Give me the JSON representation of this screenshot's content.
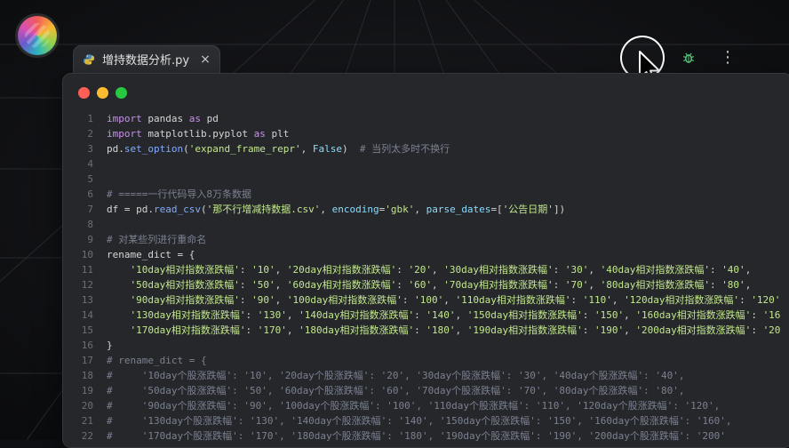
{
  "tab": {
    "title": "增持数据分析.py",
    "close_label": "×"
  },
  "toolbar": {
    "more_label": "⋮"
  },
  "icons": {
    "file_type_icon": "python-icon",
    "run_icon": "play-icon",
    "debug_icon": "bug-icon",
    "more_icon": "more-vertical-icon",
    "cursor_icon": "mouse-pointer-icon",
    "logo_icon": "app-logo-icon"
  },
  "colors": {
    "traffic_red": "#ff5f57",
    "traffic_yellow": "#febc2e",
    "traffic_green": "#28c840",
    "run_green": "#58d27f"
  },
  "code": {
    "lines": [
      {
        "n": "1",
        "segments": [
          [
            "k",
            "import"
          ],
          [
            "t",
            " pandas "
          ],
          [
            "k",
            "as"
          ],
          [
            "t",
            " pd"
          ]
        ]
      },
      {
        "n": "2",
        "segments": [
          [
            "k",
            "import"
          ],
          [
            "t",
            " matplotlib.pyplot "
          ],
          [
            "k",
            "as"
          ],
          [
            "t",
            " plt"
          ]
        ]
      },
      {
        "n": "3",
        "segments": [
          [
            "t",
            "pd."
          ],
          [
            "f",
            "set_option"
          ],
          [
            "t",
            "("
          ],
          [
            "s",
            "'expand_frame_repr'"
          ],
          [
            "t",
            ", "
          ],
          [
            "o",
            "False"
          ],
          [
            "t",
            ")  "
          ],
          [
            "c",
            "# 当列太多时不换行"
          ]
        ]
      },
      {
        "n": "4",
        "segments": [
          [
            "t",
            ""
          ]
        ]
      },
      {
        "n": "5",
        "segments": [
          [
            "t",
            ""
          ]
        ]
      },
      {
        "n": "6",
        "segments": [
          [
            "c",
            "# =====一行代码导入8万条数据"
          ]
        ]
      },
      {
        "n": "7",
        "segments": [
          [
            "t",
            "df = pd."
          ],
          [
            "f",
            "read_csv"
          ],
          [
            "t",
            "("
          ],
          [
            "s",
            "'那不行增减持数据.csv'"
          ],
          [
            "t",
            ", "
          ],
          [
            "o",
            "encoding"
          ],
          [
            "t",
            "="
          ],
          [
            "s",
            "'gbk'"
          ],
          [
            "t",
            ", "
          ],
          [
            "o",
            "parse_dates"
          ],
          [
            "t",
            "=["
          ],
          [
            "s",
            "'公告日期'"
          ],
          [
            "t",
            "])"
          ]
        ]
      },
      {
        "n": "8",
        "segments": [
          [
            "t",
            ""
          ]
        ]
      },
      {
        "n": "9",
        "segments": [
          [
            "c",
            "# 对某些列进行重命名"
          ]
        ]
      },
      {
        "n": "10",
        "segments": [
          [
            "t",
            "rename_dict = {"
          ]
        ]
      },
      {
        "n": "11",
        "segments": [
          [
            "t",
            "    "
          ],
          [
            "s",
            "'10day相对指数涨跌幅'"
          ],
          [
            "t",
            ": "
          ],
          [
            "s",
            "'10'"
          ],
          [
            "t",
            ", "
          ],
          [
            "s",
            "'20day相对指数涨跌幅'"
          ],
          [
            "t",
            ": "
          ],
          [
            "s",
            "'20'"
          ],
          [
            "t",
            ", "
          ],
          [
            "s",
            "'30day相对指数涨跌幅'"
          ],
          [
            "t",
            ": "
          ],
          [
            "s",
            "'30'"
          ],
          [
            "t",
            ", "
          ],
          [
            "s",
            "'40day相对指数涨跌幅'"
          ],
          [
            "t",
            ": "
          ],
          [
            "s",
            "'40'"
          ],
          [
            "t",
            ","
          ]
        ]
      },
      {
        "n": "12",
        "segments": [
          [
            "t",
            "    "
          ],
          [
            "s",
            "'50day相对指数涨跌幅'"
          ],
          [
            "t",
            ": "
          ],
          [
            "s",
            "'50'"
          ],
          [
            "t",
            ", "
          ],
          [
            "s",
            "'60day相对指数涨跌幅'"
          ],
          [
            "t",
            ": "
          ],
          [
            "s",
            "'60'"
          ],
          [
            "t",
            ", "
          ],
          [
            "s",
            "'70day相对指数涨跌幅'"
          ],
          [
            "t",
            ": "
          ],
          [
            "s",
            "'70'"
          ],
          [
            "t",
            ", "
          ],
          [
            "s",
            "'80day相对指数涨跌幅'"
          ],
          [
            "t",
            ": "
          ],
          [
            "s",
            "'80'"
          ],
          [
            "t",
            ","
          ]
        ]
      },
      {
        "n": "13",
        "segments": [
          [
            "t",
            "    "
          ],
          [
            "s",
            "'90day相对指数涨跌幅'"
          ],
          [
            "t",
            ": "
          ],
          [
            "s",
            "'90'"
          ],
          [
            "t",
            ", "
          ],
          [
            "s",
            "'100day相对指数涨跌幅'"
          ],
          [
            "t",
            ": "
          ],
          [
            "s",
            "'100'"
          ],
          [
            "t",
            ", "
          ],
          [
            "s",
            "'110day相对指数涨跌幅'"
          ],
          [
            "t",
            ": "
          ],
          [
            "s",
            "'110'"
          ],
          [
            "t",
            ", "
          ],
          [
            "s",
            "'120day相对指数涨跌幅'"
          ],
          [
            "t",
            ": "
          ],
          [
            "s",
            "'120'"
          ]
        ]
      },
      {
        "n": "14",
        "segments": [
          [
            "t",
            "    "
          ],
          [
            "s",
            "'130day相对指数涨跌幅'"
          ],
          [
            "t",
            ": "
          ],
          [
            "s",
            "'130'"
          ],
          [
            "t",
            ", "
          ],
          [
            "s",
            "'140day相对指数涨跌幅'"
          ],
          [
            "t",
            ": "
          ],
          [
            "s",
            "'140'"
          ],
          [
            "t",
            ", "
          ],
          [
            "s",
            "'150day相对指数涨跌幅'"
          ],
          [
            "t",
            ": "
          ],
          [
            "s",
            "'150'"
          ],
          [
            "t",
            ", "
          ],
          [
            "s",
            "'160day相对指数涨跌幅'"
          ],
          [
            "t",
            ": "
          ],
          [
            "s",
            "'16"
          ]
        ]
      },
      {
        "n": "15",
        "segments": [
          [
            "t",
            "    "
          ],
          [
            "s",
            "'170day相对指数涨跌幅'"
          ],
          [
            "t",
            ": "
          ],
          [
            "s",
            "'170'"
          ],
          [
            "t",
            ", "
          ],
          [
            "s",
            "'180day相对指数涨跌幅'"
          ],
          [
            "t",
            ": "
          ],
          [
            "s",
            "'180'"
          ],
          [
            "t",
            ", "
          ],
          [
            "s",
            "'190day相对指数涨跌幅'"
          ],
          [
            "t",
            ": "
          ],
          [
            "s",
            "'190'"
          ],
          [
            "t",
            ", "
          ],
          [
            "s",
            "'200day相对指数涨跌幅'"
          ],
          [
            "t",
            ": "
          ],
          [
            "s",
            "'20"
          ]
        ]
      },
      {
        "n": "16",
        "segments": [
          [
            "t",
            "}"
          ]
        ]
      },
      {
        "n": "17",
        "segments": [
          [
            "c",
            "# rename_dict = {"
          ]
        ]
      },
      {
        "n": "18",
        "segments": [
          [
            "c",
            "#     '10day个股涨跌幅': '10', '20day个股涨跌幅': '20', '30day个股涨跌幅': '30', '40day个股涨跌幅': '40',"
          ]
        ]
      },
      {
        "n": "19",
        "segments": [
          [
            "c",
            "#     '50day个股涨跌幅': '50', '60day个股涨跌幅': '60', '70day个股涨跌幅': '70', '80day个股涨跌幅': '80',"
          ]
        ]
      },
      {
        "n": "20",
        "segments": [
          [
            "c",
            "#     '90day个股涨跌幅': '90', '100day个股涨跌幅': '100', '110day个股涨跌幅': '110', '120day个股涨跌幅': '120',"
          ]
        ]
      },
      {
        "n": "21",
        "segments": [
          [
            "c",
            "#     '130day个股涨跌幅': '130', '140day个股涨跌幅': '140', '150day个股涨跌幅': '150', '160day个股涨跌幅': '160',"
          ]
        ]
      },
      {
        "n": "22",
        "segments": [
          [
            "c",
            "#     '170day个股涨跌幅': '170', '180day个股涨跌幅': '180', '190day个股涨跌幅': '190', '200day个股涨跌幅': '200'"
          ]
        ]
      }
    ]
  }
}
